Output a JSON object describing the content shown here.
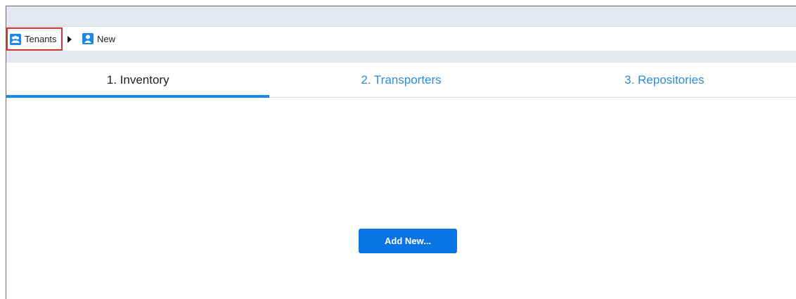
{
  "breadcrumb": {
    "tenants_label": "Tenants",
    "new_label": "New"
  },
  "tabs": [
    {
      "label": "1. Inventory",
      "active": true
    },
    {
      "label": "2. Transporters",
      "active": false
    },
    {
      "label": "3. Repositories",
      "active": false
    }
  ],
  "main": {
    "add_button_label": "Add New..."
  },
  "colors": {
    "accent": "#1e88e5",
    "button": "#0b74e5",
    "highlight_border": "#e0302f"
  },
  "icons": {
    "tenants": "group-users-icon",
    "new": "user-icon",
    "separator": "triangle-right-icon"
  }
}
